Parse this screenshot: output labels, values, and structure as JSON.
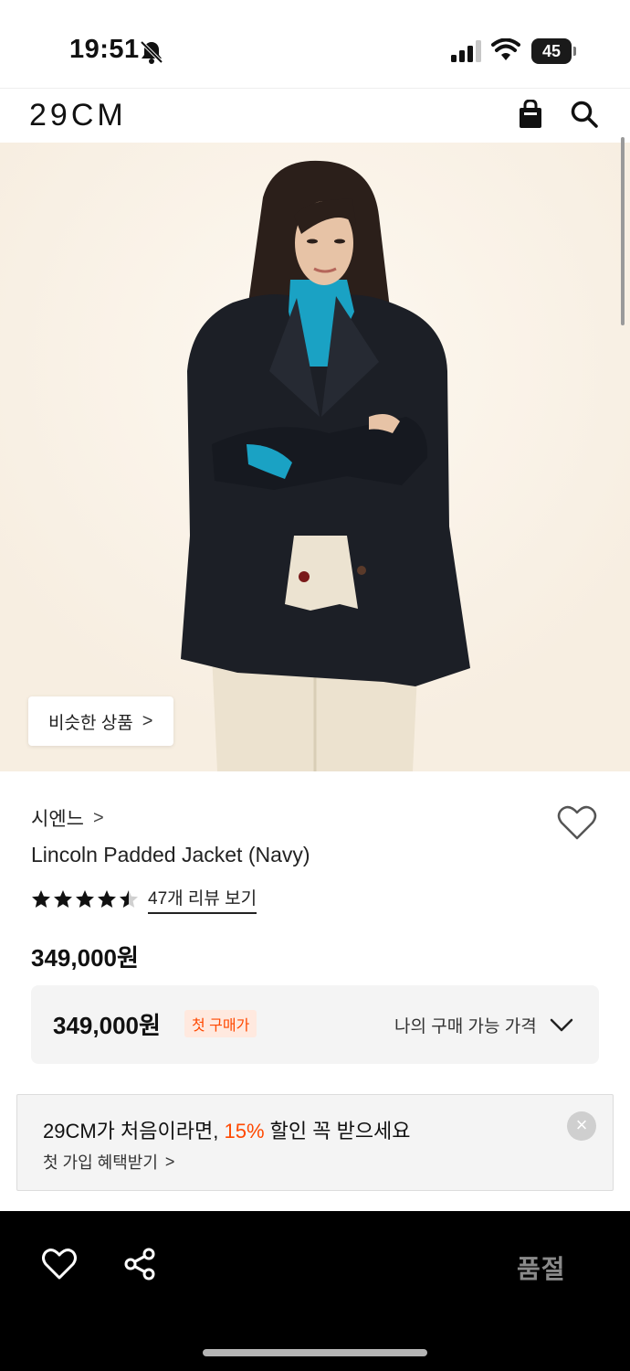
{
  "status_bar": {
    "time": "19:51",
    "battery_level": "45",
    "icons": [
      "bell-slash-icon",
      "cellular-signal-icon",
      "wifi-icon",
      "battery-icon"
    ]
  },
  "header": {
    "logo": "29CM",
    "icons": [
      "shopping-bag-icon",
      "search-icon"
    ]
  },
  "hero": {
    "similar_button": "비슷한 상품",
    "similar_chevron": ">"
  },
  "product": {
    "brand": "시엔느",
    "brand_chevron": ">",
    "name": "Lincoln Padded Jacket (Navy)",
    "rating": 4.5,
    "rating_max": 5,
    "review_link": "47개 리뷰 보기",
    "price": "349,000원"
  },
  "price_box": {
    "price": "349,000원",
    "badge": "첫 구매가",
    "label": "나의 구매 가능 가격"
  },
  "coupon": {
    "title_prefix": "29CM가 처음이라면, ",
    "title_accent": "15%",
    "title_suffix": " 할인 꼭 받으세요",
    "subtitle": "첫 가입 혜택받기",
    "subtitle_chevron": ">",
    "close": "×"
  },
  "bottom_bar": {
    "soldout_label": "품절",
    "icons": [
      "heart-icon",
      "share-icon"
    ]
  },
  "colors": {
    "accent": "#ff4800",
    "hero_bg": "#f9f1e6",
    "bottom_bar_bg": "#000000"
  }
}
